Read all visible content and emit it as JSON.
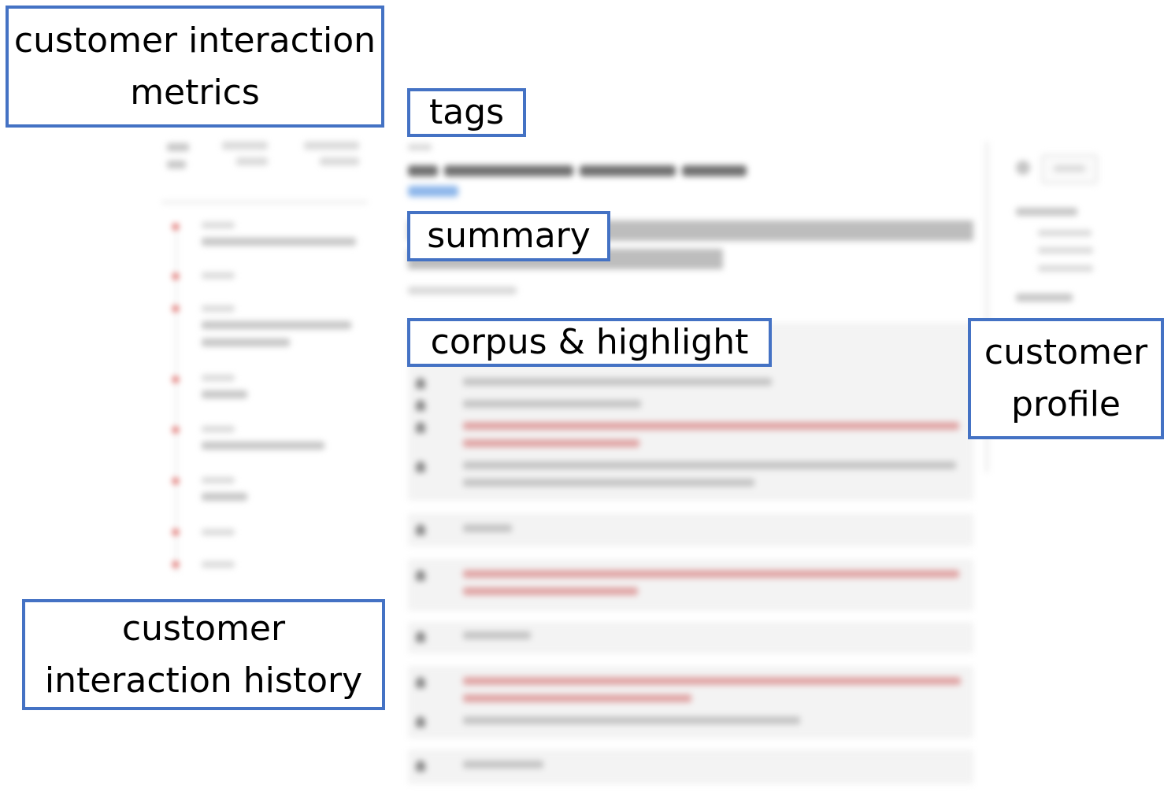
{
  "labels": {
    "metrics": "customer interaction metrics",
    "history": "customer interaction history",
    "tags": "tags",
    "summary": "summary",
    "corpus": "corpus & highlight",
    "profile": "customer profile"
  },
  "colors": {
    "label_border": "#4472c4",
    "highlight_red": "#d9534f",
    "tag_blue": "#8cb6ea"
  }
}
